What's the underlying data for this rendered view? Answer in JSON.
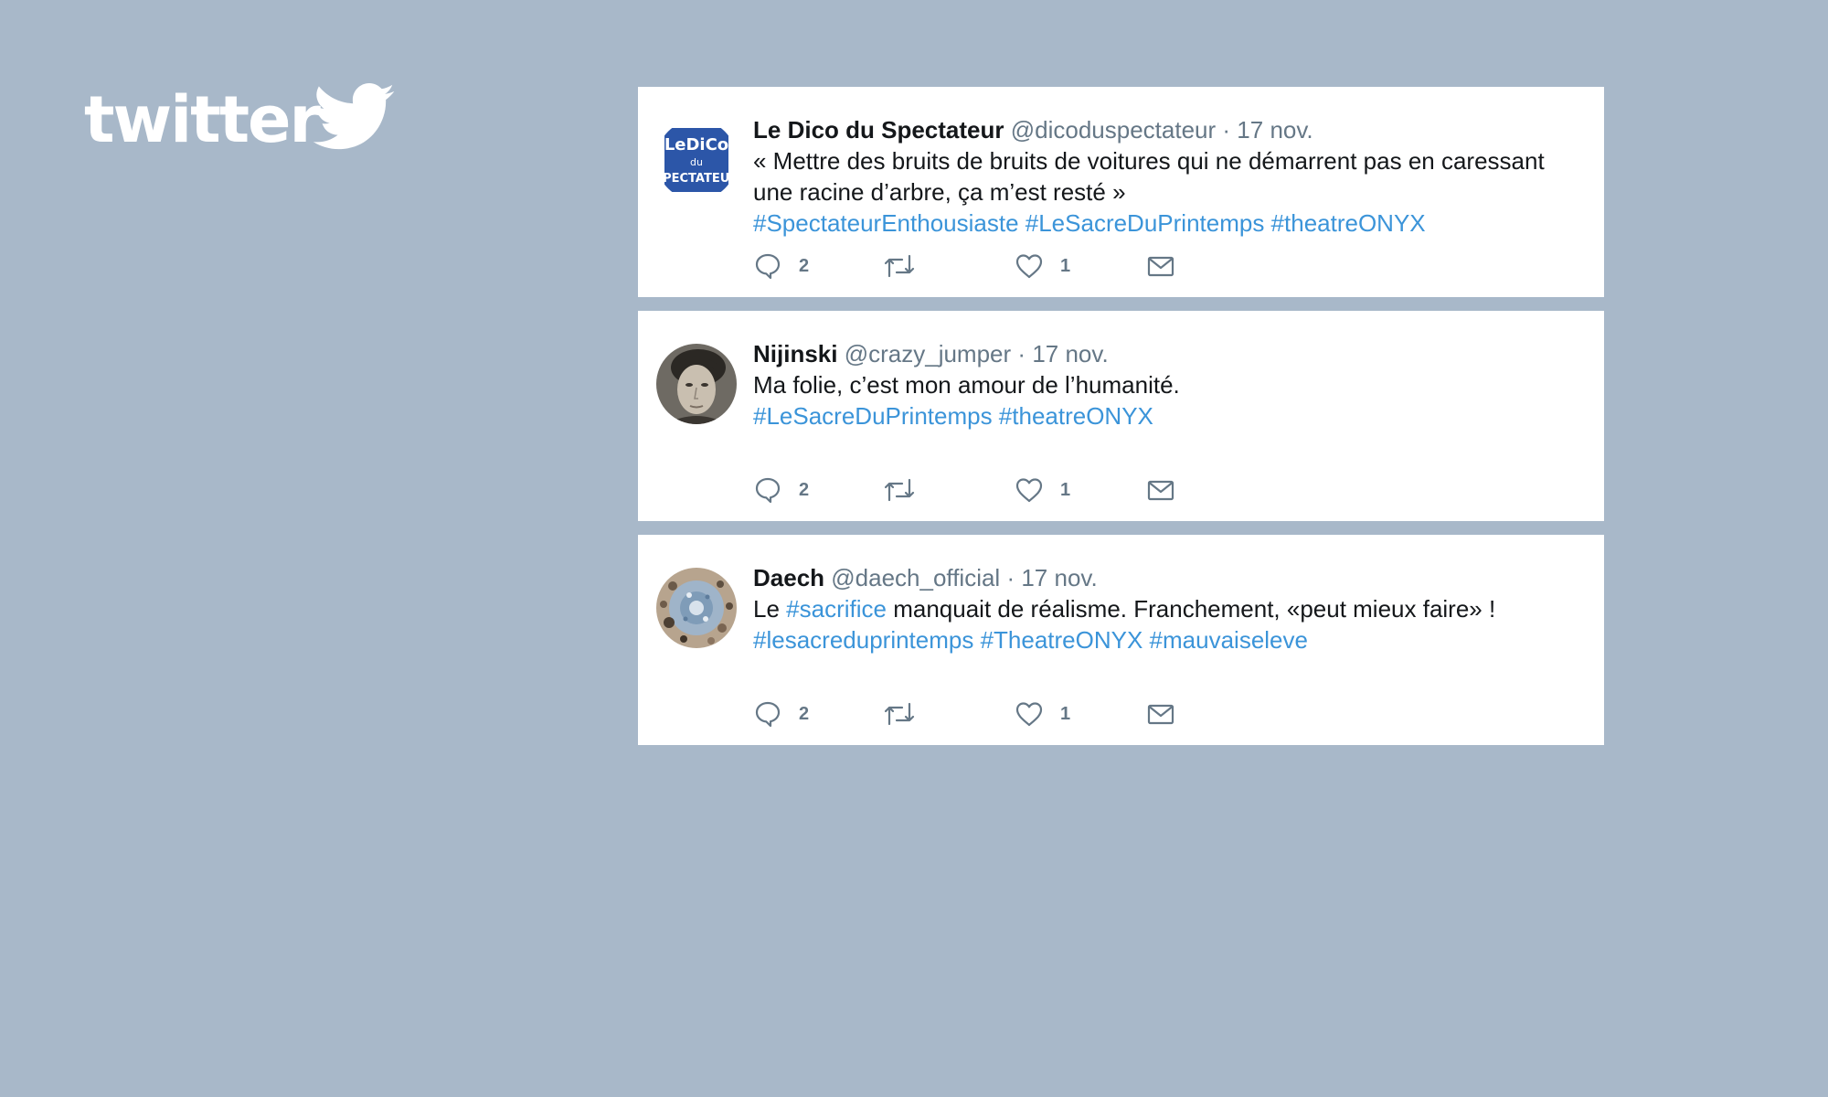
{
  "logo": {
    "text": "twitter",
    "icon": "bird-icon",
    "color": "#ffffff"
  },
  "colors": {
    "background": "#a8b8c9",
    "link": "#3b94d9",
    "muted": "#657786",
    "text": "#14171a"
  },
  "tweets": [
    {
      "name": "Le Dico du Spectateur",
      "handle": "@dicoduspectateur",
      "separator": "·",
      "date": "17 nov.",
      "avatar": "dico-logo-avatar",
      "text_lines": [
        "« Mettre des bruits de bruits de voitures qui ne démarrent pas en caressant",
        "une racine d’arbre, ça m’est resté »"
      ],
      "hashtags": "#SpectateurEnthousiaste #LeSacreDuPrintemps #theatreONYX",
      "reply_count": "2",
      "like_count": "1"
    },
    {
      "name": "Nijinski",
      "handle": "@crazy_jumper",
      "separator": "·",
      "date": "17 nov.",
      "avatar": "portrait-avatar",
      "text_lines": [
        "Ma folie, c’est mon amour de l’humanité."
      ],
      "hashtags": "#LeSacreDuPrintemps #theatreONYX",
      "reply_count": "2",
      "like_count": "1"
    },
    {
      "name": "Daech",
      "handle": "@daech_official",
      "separator": "·",
      "date": "17 nov.",
      "avatar": "mosaic-avatar",
      "text_parts": {
        "before": "Le ",
        "tag": "#sacrifice",
        "after": " manquait de réalisme. Franchement, «peut mieux faire» !"
      },
      "hashtags": "#lesacreduprintemps #TheatreONYX #mauvaiseleve",
      "reply_count": "2",
      "like_count": "1"
    }
  ]
}
